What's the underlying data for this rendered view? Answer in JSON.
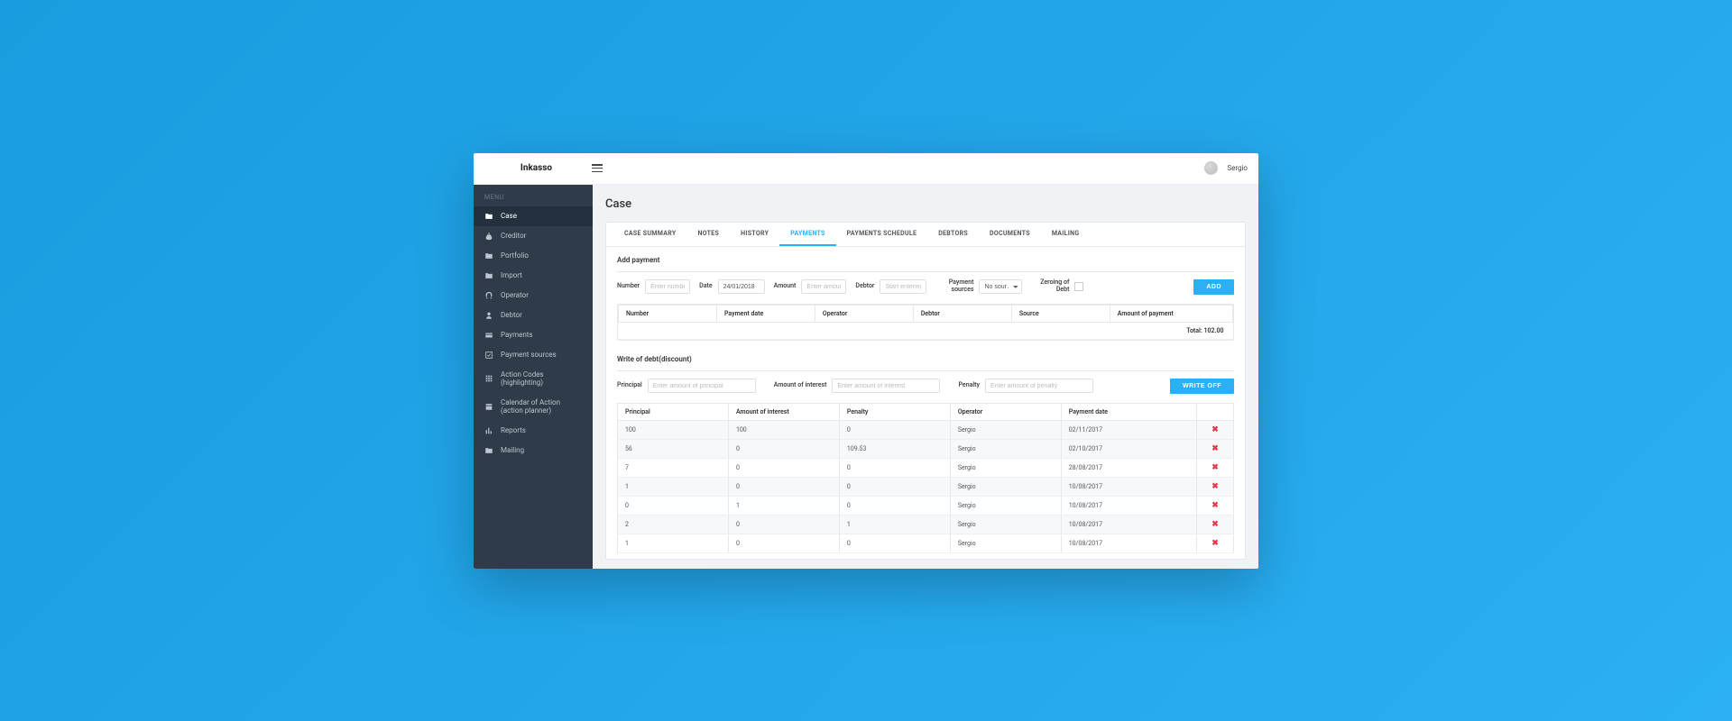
{
  "brand": "Inkasso",
  "user": {
    "name": "Sergio"
  },
  "sidebar": {
    "header": "MENU",
    "items": [
      {
        "label": "Case"
      },
      {
        "label": "Creditor"
      },
      {
        "label": "Portfolio"
      },
      {
        "label": "Import"
      },
      {
        "label": "Operator"
      },
      {
        "label": "Debtor"
      },
      {
        "label": "Payments"
      },
      {
        "label": "Payment sources"
      },
      {
        "label": "Action Codes (highlighting)"
      },
      {
        "label": "Calendar of Action (action planner)"
      },
      {
        "label": "Reports"
      },
      {
        "label": "Mailing"
      }
    ]
  },
  "page": {
    "title": "Case"
  },
  "tabs": [
    {
      "label": "CASE SUMMARY"
    },
    {
      "label": "NOTES"
    },
    {
      "label": "HISTORY"
    },
    {
      "label": "PAYMENTS"
    },
    {
      "label": "PAYMENTS SCHEDULE"
    },
    {
      "label": "DEBTORS"
    },
    {
      "label": "DOCUMENTS"
    },
    {
      "label": "MAILING"
    }
  ],
  "addPayment": {
    "title": "Add payment",
    "number": {
      "label": "Number",
      "placeholder": "Enter number"
    },
    "date": {
      "label": "Date",
      "value": "24/01/2018"
    },
    "amount": {
      "label": "Amount",
      "placeholder": "Enter amount"
    },
    "debtor": {
      "label": "Debtor",
      "placeholder": "Start entering de"
    },
    "sources": {
      "label": "Payment sources",
      "value": "No sour…"
    },
    "zeroing": {
      "label": "Zeroing of Debt"
    },
    "addBtn": "ADD"
  },
  "paymentsTable": {
    "headers": [
      "Number",
      "Payment date",
      "Operator",
      "Debtor",
      "Source",
      "Amount of payment"
    ],
    "totalLabel": "Total:",
    "totalValue": "102.00"
  },
  "writeOff": {
    "title": "Write of debt(discount)",
    "principal": {
      "label": "Principal",
      "placeholder": "Enter amount of principal"
    },
    "interest": {
      "label": "Amount of interest",
      "placeholder": "Enter amount of interest"
    },
    "penalty": {
      "label": "Penalty",
      "placeholder": "Enter amount of penalty"
    },
    "btn": "WRITE OFF",
    "headers": [
      "Principal",
      "Amount of interest",
      "Penalty",
      "Operator",
      "Payment date"
    ],
    "rows": [
      {
        "principal": "100",
        "interest": "100",
        "penalty": "0",
        "operator": "Sergio",
        "date": "02/11/2017"
      },
      {
        "principal": "56",
        "interest": "0",
        "penalty": "109.53",
        "operator": "Sergio",
        "date": "02/10/2017"
      },
      {
        "principal": "7",
        "interest": "0",
        "penalty": "0",
        "operator": "Sergio",
        "date": "28/08/2017"
      },
      {
        "principal": "1",
        "interest": "0",
        "penalty": "0",
        "operator": "Sergio",
        "date": "10/08/2017"
      },
      {
        "principal": "0",
        "interest": "1",
        "penalty": "0",
        "operator": "Sergio",
        "date": "10/08/2017"
      },
      {
        "principal": "2",
        "interest": "0",
        "penalty": "1",
        "operator": "Sergio",
        "date": "10/08/2017"
      },
      {
        "principal": "1",
        "interest": "0",
        "penalty": "0",
        "operator": "Sergio",
        "date": "10/08/2017"
      }
    ]
  }
}
